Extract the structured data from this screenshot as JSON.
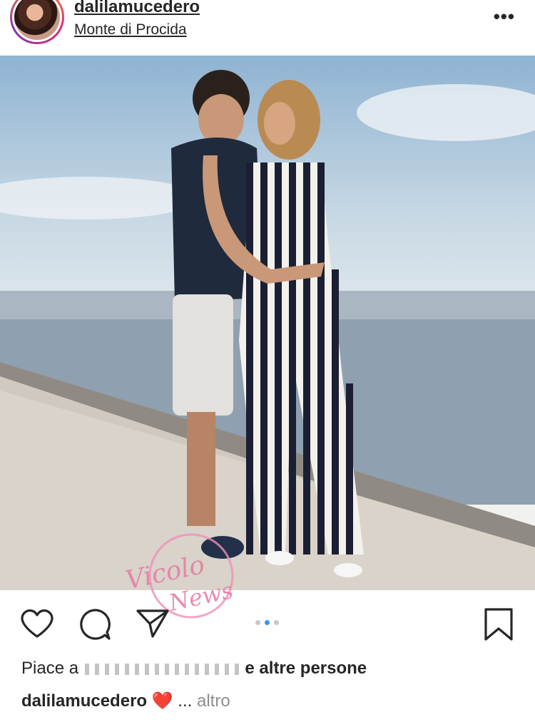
{
  "header": {
    "username": "dalilamucedero",
    "location": "Monte di Procida",
    "more_icon": "more-options-icon",
    "more_glyph": "•••"
  },
  "post": {
    "photo_description_icon": "photo",
    "carousel": {
      "total": 3,
      "active": 2
    }
  },
  "actions": {
    "like_icon": "heart-outline-icon",
    "comment_icon": "comment-bubble-icon",
    "share_icon": "paper-plane-icon",
    "save_icon": "bookmark-icon"
  },
  "likes": {
    "prefix": "Piace a",
    "suffix": "e altre persone"
  },
  "caption": {
    "username": "dalilamucedero",
    "emoji": "❤️",
    "ellipsis": "...",
    "more": "altro"
  },
  "watermark": {
    "line1": "Vicolo",
    "line2": "News"
  },
  "colors": {
    "text": "#262626",
    "muted": "#8e8e8e",
    "accent": "#3897f0",
    "heart": "#e0245e"
  }
}
